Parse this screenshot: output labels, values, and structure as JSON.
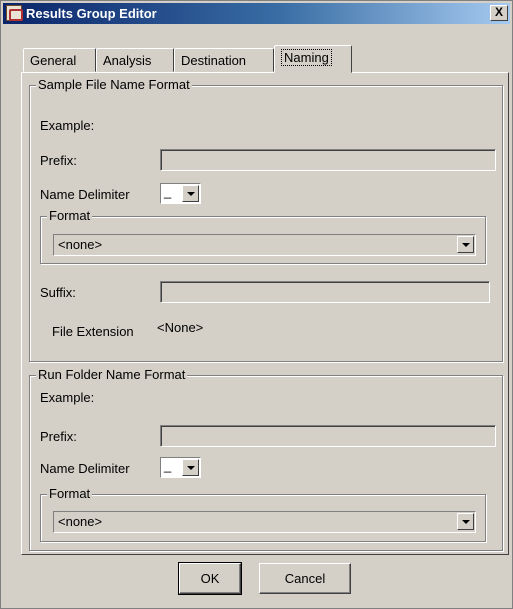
{
  "window": {
    "title": "Results Group Editor",
    "close_label": "X"
  },
  "tabs": [
    {
      "label": "General"
    },
    {
      "label": "Analysis"
    },
    {
      "label": "Destination"
    },
    {
      "label": "Naming"
    }
  ],
  "sample": {
    "legend": "Sample File Name Format",
    "example_label": "Example:",
    "prefix_label": "Prefix:",
    "prefix_value": "",
    "delimiter_label": "Name Delimiter",
    "delimiter_value": "_",
    "format_legend": "Format",
    "format_value": "<none>",
    "suffix_label": "Suffix:",
    "suffix_value": "",
    "extension_label": "File Extension",
    "extension_value": "<None>"
  },
  "run": {
    "legend": "Run Folder Name Format",
    "example_label": "Example:",
    "prefix_label": "Prefix:",
    "prefix_value": "",
    "delimiter_label": "Name Delimiter",
    "delimiter_value": "_",
    "format_legend": "Format",
    "format_value": "<none>"
  },
  "buttons": {
    "ok": "OK",
    "cancel": "Cancel"
  },
  "colors": {
    "face": "#d4d0c8",
    "titlebar_start": "#0a246a",
    "titlebar_end": "#a6caf0"
  },
  "icons": {
    "app": "results-group-app-icon",
    "dropdown": "chevron-down-icon"
  }
}
